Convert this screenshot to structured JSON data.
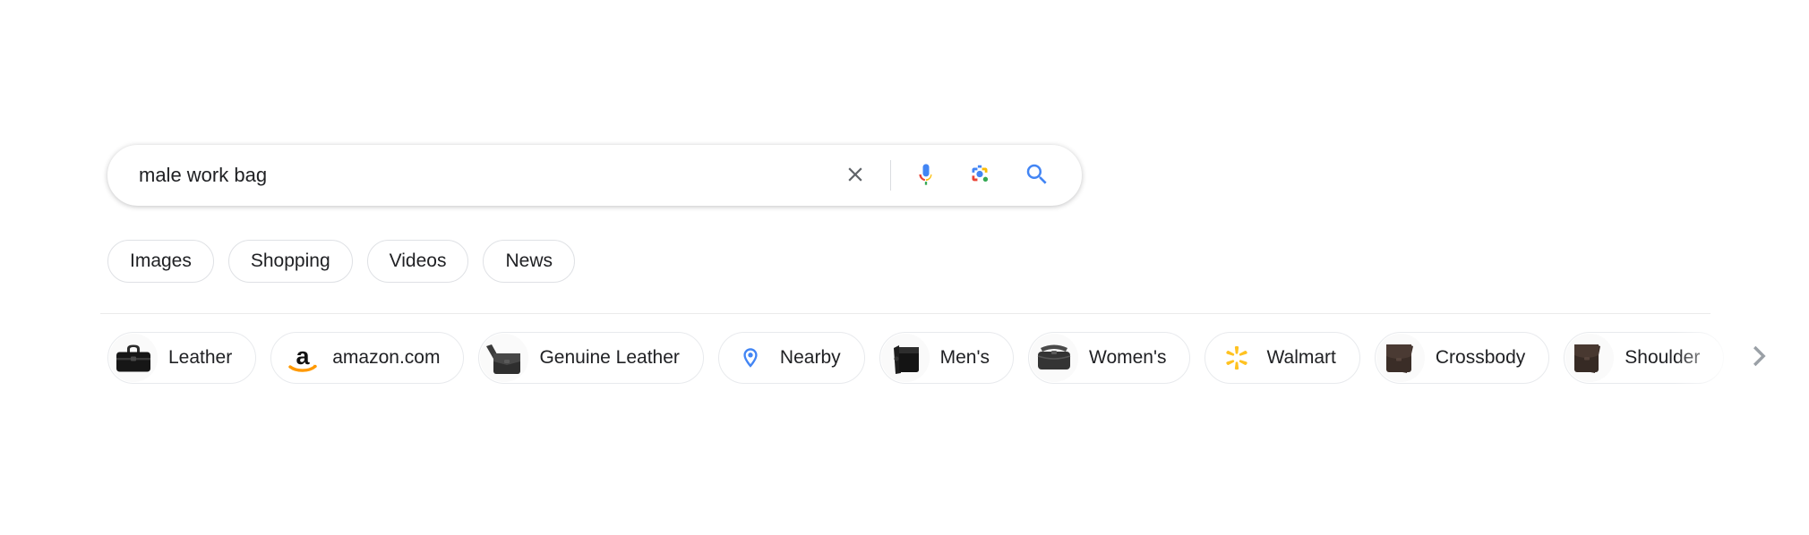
{
  "search": {
    "value": "male work bag",
    "placeholder": "Search",
    "clear_label": "Clear",
    "voice_label": "Search by voice",
    "lens_label": "Search by image",
    "submit_label": "Google Search"
  },
  "tabs": [
    {
      "label": "Images"
    },
    {
      "label": "Shopping"
    },
    {
      "label": "Videos"
    },
    {
      "label": "News"
    }
  ],
  "related_chips": [
    {
      "label": "Leather",
      "icon": "briefcase-bag-thumbnail"
    },
    {
      "label": "amazon.com",
      "icon": "amazon-logo"
    },
    {
      "label": "Genuine Leather",
      "icon": "messenger-bag-thumbnail"
    },
    {
      "label": "Nearby",
      "icon": "location-pin-icon"
    },
    {
      "label": "Men's",
      "icon": "mens-bag-thumbnail"
    },
    {
      "label": "Women's",
      "icon": "womens-bag-thumbnail"
    },
    {
      "label": "Walmart",
      "icon": "walmart-spark-logo"
    },
    {
      "label": "Crossbody",
      "icon": "crossbody-bag-thumbnail"
    },
    {
      "label": "Shoulder",
      "icon": "shoulder-bag-thumbnail"
    }
  ],
  "scroll_arrow_label": "Scroll right",
  "colors": {
    "google_blue": "#4285F4",
    "google_red": "#EA4335",
    "google_yellow": "#FBBC05",
    "google_green": "#34A853",
    "amazon_orange": "#FF9900",
    "walmart_yellow": "#FFC220",
    "text": "#202124",
    "border": "#dfe1e5",
    "divider": "#ebebeb"
  }
}
